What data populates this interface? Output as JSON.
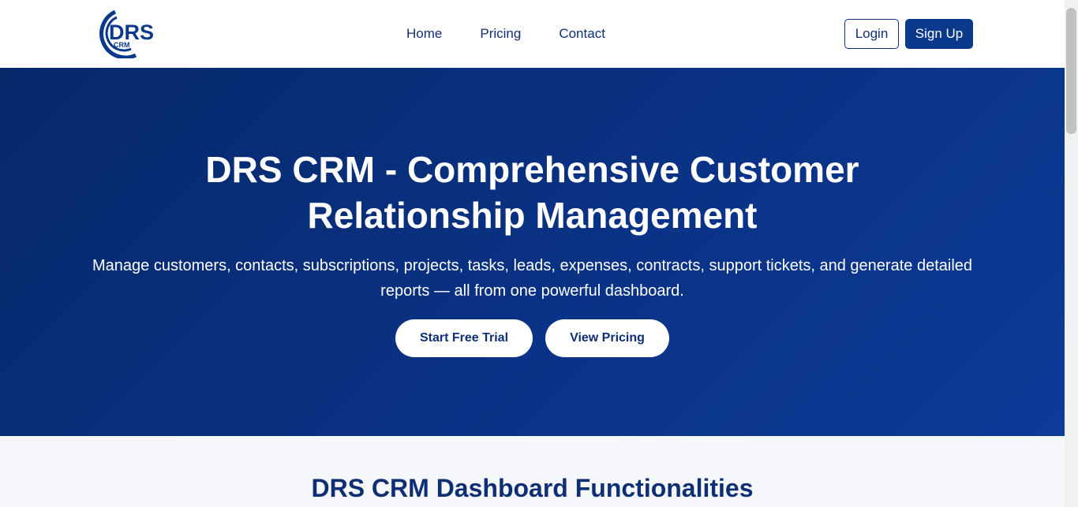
{
  "header": {
    "logo_text": "DRS",
    "logo_subtext": "CRM",
    "nav": [
      {
        "label": "Home"
      },
      {
        "label": "Pricing"
      },
      {
        "label": "Contact"
      }
    ],
    "login_label": "Login",
    "signup_label": "Sign Up"
  },
  "hero": {
    "title": "DRS CRM - Comprehensive Customer Relationship Management",
    "subtitle": "Manage customers, contacts, subscriptions, projects, tasks, leads, expenses, contracts, support tickets, and generate detailed reports — all from one powerful dashboard.",
    "cta_primary": "Start Free Trial",
    "cta_secondary": "View Pricing"
  },
  "features": {
    "title": "DRS CRM Dashboard Functionalities"
  },
  "colors": {
    "brand": "#0b3a8c",
    "hero_start": "#07296a",
    "hero_end": "#0d3b98",
    "text_dark": "#0f2f75"
  }
}
